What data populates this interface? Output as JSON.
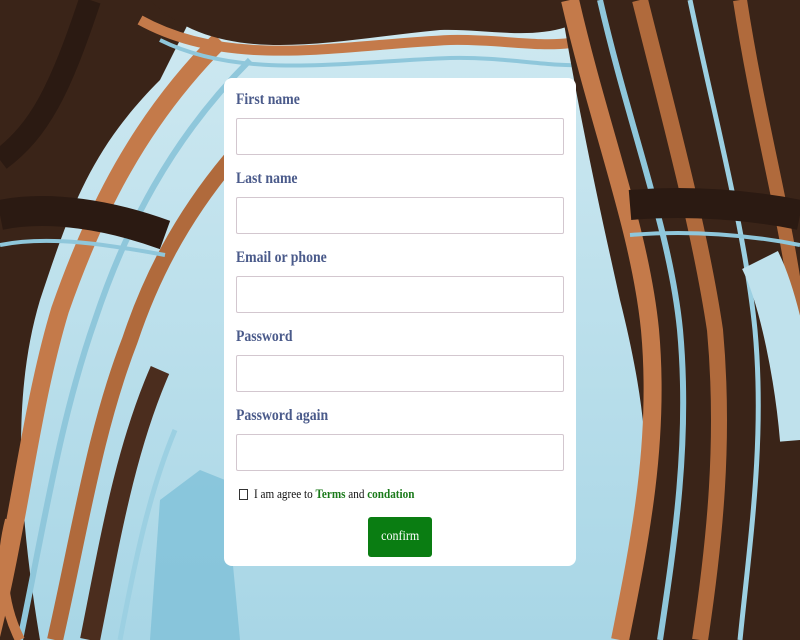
{
  "form": {
    "fields": [
      {
        "label": "First name",
        "value": "",
        "placeholder": ""
      },
      {
        "label": "Last name",
        "value": "",
        "placeholder": ""
      },
      {
        "label": "Email or phone",
        "value": "",
        "placeholder": ""
      },
      {
        "label": "Password",
        "value": "",
        "placeholder": ""
      },
      {
        "label": "Password again",
        "value": "",
        "placeholder": ""
      }
    ],
    "agree": {
      "prefix": "I am agree to",
      "terms_link": "Terms",
      "and": "and",
      "condition_link": "condation",
      "checked": false
    },
    "confirm_label": "confirm"
  },
  "colors": {
    "label": "#4a5a8a",
    "link": "#1a7a1a",
    "button": "#0a7d12",
    "card": "#ffffff",
    "sky": "#bfe1ec"
  }
}
